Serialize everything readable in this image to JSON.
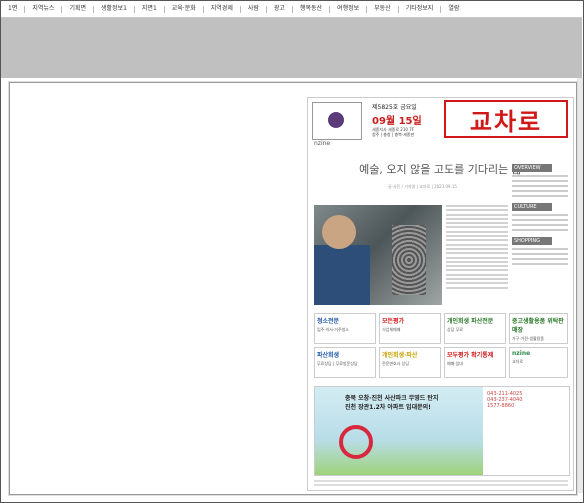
{
  "menu": [
    "1면",
    "지역뉴스",
    "기획면",
    "생활정보1",
    "지면1",
    "교육·문화",
    "지역경제",
    "사람",
    "광고",
    "행복동산",
    "여행정보",
    "부동산",
    "기타정보지",
    "열람"
  ],
  "newspaper": {
    "brand": "교차로",
    "issue_no": "제5825호 금요일",
    "date": "09월 15일",
    "small_lines": [
      "세종지사 세종로 210 7F",
      "청주 | 충청 | 충북·세종판"
    ],
    "nzine": "nzine",
    "headline": "예술, 오지 않을 고도를 기다리는 삶",
    "byline": "글·사진 / 기자명 | 교차로 | 2023.09.15",
    "side_labels": [
      "OVERVIEW",
      "CULTURE",
      "SHOPPING"
    ],
    "ads": [
      {
        "title": "청소전문",
        "sub": "입주·이사·거주청소"
      },
      {
        "title": "모든평가",
        "sub": "식업체매매"
      },
      {
        "title": "개인회생 파산전문",
        "sub": "상담 무료"
      },
      {
        "title": "중고생활용품 위탁판매장",
        "sub": "가구·가전·생활용품"
      },
      {
        "title": "파산회생",
        "sub": "무료상담 | 무료방문상담"
      },
      {
        "title": "개인회생·파산",
        "sub": "전문변호사 상담"
      },
      {
        "title": "모두평가 확기통제",
        "sub": "매매·임대"
      },
      {
        "title": "nzine",
        "sub": "교차로"
      }
    ],
    "banner_text1": "충북 오창·진천 사산파크 무영드 탄지",
    "banner_text2": "진천 장관1.2차 아파트 입대문의!",
    "banner_phones": [
      "043-211-4025",
      "043-237-4040",
      "1577-8860"
    ]
  }
}
